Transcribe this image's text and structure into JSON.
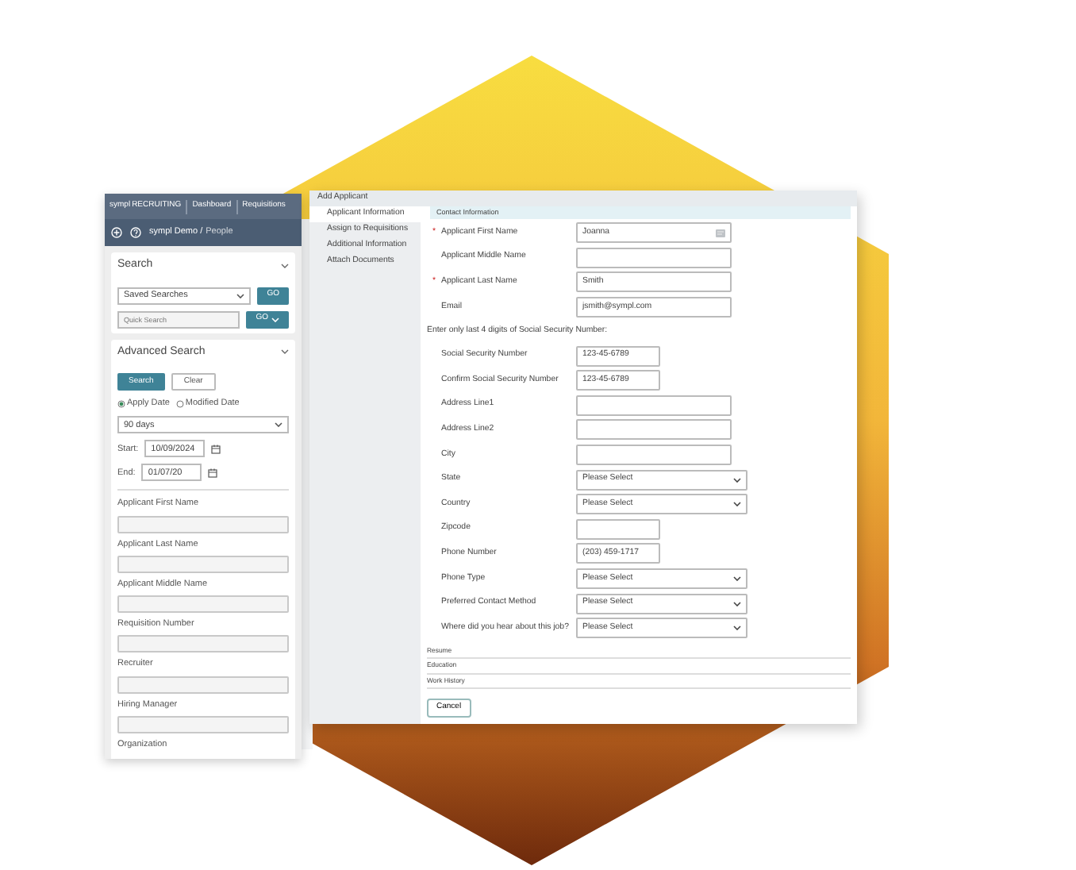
{
  "app": {
    "brand": "sympl",
    "product": "RECRUITING",
    "nav": [
      "Dashboard",
      "Requisitions"
    ],
    "breadcrumb": "sympl Demo /",
    "page": "People"
  },
  "search": {
    "title": "Search",
    "expanded": true,
    "saved_searches": "Saved Searches",
    "go": "GO",
    "quick_search_placeholder": "Quick Search",
    "quick_go": "GO"
  },
  "advanced_search": {
    "title": "Advanced Search",
    "expanded": true,
    "buttons": [
      {
        "label": "Search",
        "kind": "primary"
      },
      {
        "label": "Clear",
        "kind": "secondary"
      }
    ],
    "date_types": [
      {
        "label": "Apply Date",
        "selected": true
      },
      {
        "label": "Modified Date",
        "selected": false
      }
    ],
    "range": "90 days",
    "start_label": "Start:",
    "start": "10/09/2024",
    "end_label": "End:",
    "end": "01/07/20",
    "fields": [
      "Applicant First Name",
      "Applicant Last Name",
      "Applicant Middle Name",
      "Requisition Number",
      "Recruiter",
      "Hiring Manager"
    ],
    "cut_field": "Organization"
  },
  "modal": {
    "title": "Add Applicant",
    "nav": [
      {
        "label": "Applicant Information",
        "selected": true
      },
      {
        "label": "Assign to Requisitions",
        "selected": false
      },
      {
        "label": "Additional Information",
        "selected": false
      },
      {
        "label": "Attach Documents",
        "selected": false
      }
    ],
    "section": "Contact Information",
    "required_marker": "*",
    "fields": [
      {
        "kind": "text",
        "label": "Applicant First Name",
        "required": true,
        "value": "Joanna",
        "lookup": true
      },
      {
        "kind": "text",
        "label": "Applicant Middle Name",
        "required": false
      },
      {
        "kind": "text",
        "label": "Applicant Last Name",
        "required": true,
        "value": "Smith"
      },
      {
        "kind": "text",
        "label": "Email",
        "required": false,
        "value": "jsmith@sympl.com"
      },
      {
        "kind": "note",
        "label": "Enter only last 4 digits of Social Security Number:"
      },
      {
        "kind": "short",
        "label": "Social Security Number",
        "required": false,
        "value": "123-45-6789"
      },
      {
        "kind": "short",
        "label": "Confirm Social Security Number",
        "required": false,
        "value": "123-45-6789"
      },
      {
        "kind": "text",
        "label": "Address Line1",
        "required": false
      },
      {
        "kind": "text",
        "label": "Address Line2",
        "required": false
      },
      {
        "kind": "text",
        "label": "City",
        "required": false
      },
      {
        "kind": "select",
        "label": "State",
        "required": false,
        "value": "Please Select"
      },
      {
        "kind": "select",
        "label": "Country",
        "required": false,
        "value": "Please Select"
      },
      {
        "kind": "short",
        "label": "Zipcode",
        "required": false
      },
      {
        "kind": "short",
        "label": "Phone Number",
        "required": false,
        "value": "(203) 459-1717"
      },
      {
        "kind": "select",
        "label": "Phone Type",
        "required": false,
        "value": "Please Select"
      },
      {
        "kind": "select",
        "label": "Preferred Contact Method",
        "required": false,
        "value": "Please Select"
      },
      {
        "kind": "select",
        "label": "Where did you hear about this job?",
        "required": false,
        "value": "Please Select"
      }
    ],
    "collapsed_sections": [
      "Resume",
      "Education",
      "Work History"
    ],
    "cancel": "Cancel"
  }
}
